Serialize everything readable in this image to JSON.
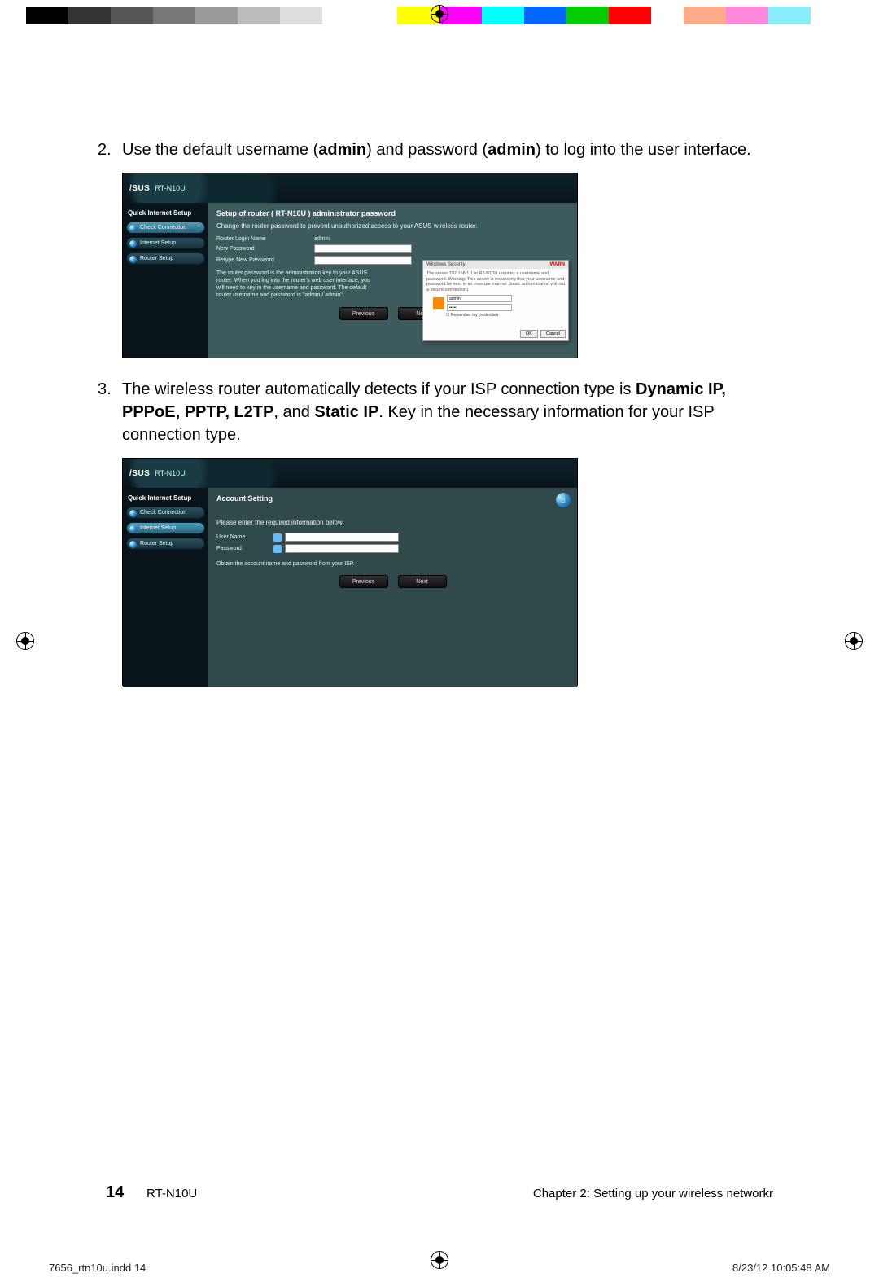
{
  "colorbar": [
    "#000",
    "#333",
    "#555",
    "#777",
    "#999",
    "#bbb",
    "#ddd",
    "#fff",
    "GAP",
    "#ff0",
    "#f0f",
    "#0ff",
    "#06f",
    "#0c0",
    "#f00",
    "GAP",
    "#fa8",
    "#f8d",
    "#8ef",
    "#fff"
  ],
  "step2": {
    "num": "2.",
    "prefix": "Use the default username (",
    "b1": "admin",
    "mid1": ") and password (",
    "b2": "admin",
    "suffix": ") to log into the user interface."
  },
  "step3": {
    "num": "3.",
    "prefix": "The wireless router automatically detects if your ISP connection type is ",
    "b1": "Dynamic IP, PPPoE, PPTP, L2TP",
    "mid1": ", and ",
    "b2": "Static IP",
    "suffix": ". Key in the necessary information for your ISP connection type."
  },
  "router": {
    "brand": "/SUS",
    "model": "RT-N10U",
    "sidebar_title": "Quick Internet Setup",
    "items": [
      "Check Connection",
      "Internet Setup",
      "Router Setup"
    ]
  },
  "shot1": {
    "title": "Setup of router ( RT-N10U ) administrator password",
    "sub": "Change the router password to prevent unauthorized access to your ASUS wireless router.",
    "f1": "Router Login Name",
    "f1v": "admin",
    "f2": "New Password",
    "f3": "Retype New Password",
    "note": "The router password is the administration key to your ASUS router. When you log into the router's web user interface, you will need to key in the username and password. The default router username and password is \"admin / admin\".",
    "popup_title": "Windows Security",
    "popup_warn": "WARN",
    "popup_text": "The server 192.168.1.1 at RT-N10U requires a username and password. Warning: This server is requesting that your username and password be sent in an insecure manner (basic authentication without a secure connection).",
    "popup_user": "admin",
    "popup_pass": "•••••",
    "popup_remember": "Remember my credentials",
    "ok": "OK",
    "cancel": "Cancel",
    "prev": "Previous",
    "next": "Next"
  },
  "shot2": {
    "title": "Account Setting",
    "sub": "Please enter the required information below.",
    "f1": "User Name",
    "f2": "Password",
    "hint": "Obtain the account name and password from your ISP.",
    "prev": "Previous",
    "next": "Next"
  },
  "footer": {
    "page": "14",
    "model": "RT-N10U",
    "chapter": "Chapter 2: Setting up your wireless networkr"
  },
  "indd": {
    "file": "7656_rtn10u.indd   14",
    "stamp": "8/23/12   10:05:48 AM"
  }
}
